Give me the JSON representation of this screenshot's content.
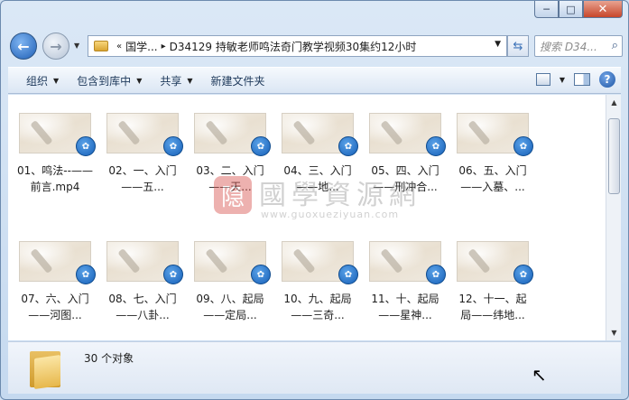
{
  "window": {
    "caption": {
      "minimize": "─",
      "maximize": "□",
      "close": "✕"
    }
  },
  "nav": {
    "back_glyph": "←",
    "forward_glyph": "→",
    "breadcrumb": {
      "overflow": "«",
      "items": [
        "国学...",
        "D34129 持敏老师鸣法奇门教学视频30集约12小时"
      ],
      "separator": "▸"
    },
    "refresh_glyph": "⇆",
    "search_placeholder": "搜索 D34...",
    "search_glyph": "⌕"
  },
  "toolbar": {
    "organize": "组织",
    "include_in_library": "包含到库中",
    "share": "共享",
    "new_folder": "新建文件夹",
    "help": "?"
  },
  "files": [
    {
      "label": "01、鸣法--——前言.mp4"
    },
    {
      "label": "02、一、入门——五..."
    },
    {
      "label": "03、二、入门——天..."
    },
    {
      "label": "04、三、入门——地..."
    },
    {
      "label": "05、四、入门——刑冲合..."
    },
    {
      "label": "06、五、入门——入墓、..."
    },
    {
      "label": "07、六、入门——河图..."
    },
    {
      "label": "08、七、入门——八卦..."
    },
    {
      "label": "09、八、起局——定局..."
    },
    {
      "label": "10、九、起局——三奇..."
    },
    {
      "label": "11、十、起局——星神..."
    },
    {
      "label": "12、十一、起局——纬地..."
    }
  ],
  "badge_glyph": "✿",
  "watermark": {
    "seal": "隐",
    "text": "國學資源網",
    "url": "www.guoxueziyuan.com"
  },
  "status": {
    "count_text": "30 个对象"
  },
  "cursor_glyph": "↖"
}
